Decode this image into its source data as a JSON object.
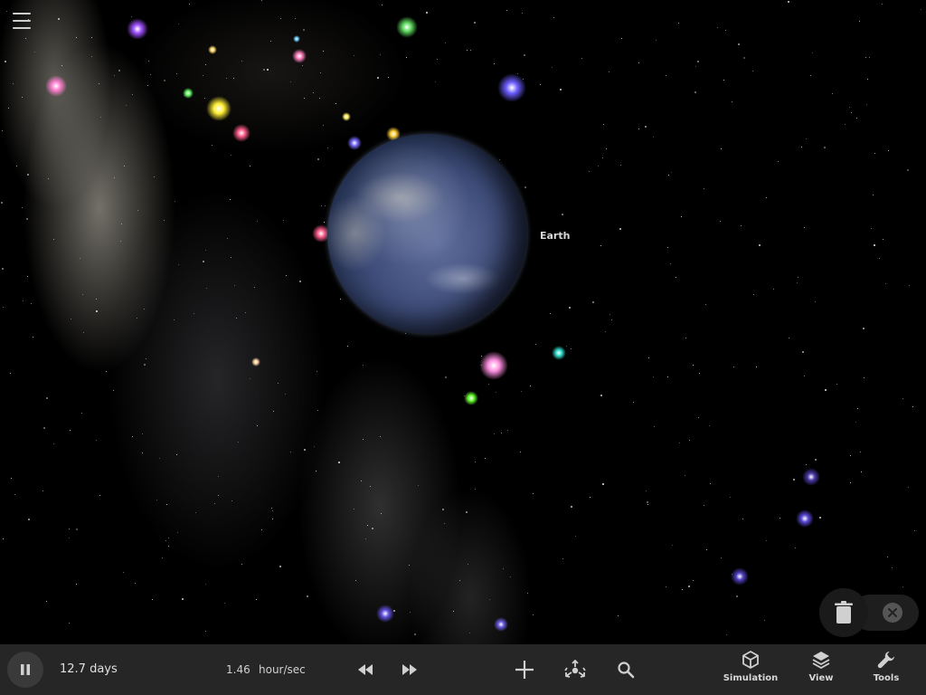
{
  "scene": {
    "planet_label": "Earth"
  },
  "toolbar": {
    "elapsed_time": "12.7 days",
    "time_rate_value": "1.46",
    "time_rate_unit": "hour/sec",
    "nav": [
      {
        "label": "Simulation",
        "icon": "cube-icon"
      },
      {
        "label": "View",
        "icon": "layers-icon"
      },
      {
        "label": "Tools",
        "icon": "wrench-icon"
      }
    ]
  },
  "colors": {
    "toolbar_bg": "#262626",
    "icon": "#cfcfcf",
    "text": "#d8d8d8"
  }
}
